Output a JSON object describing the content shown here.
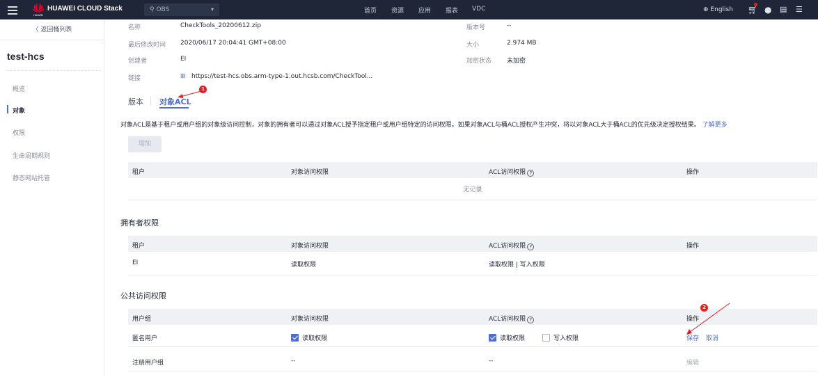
{
  "topbar": {
    "brand": "HUAWEI CLOUD Stack",
    "logo_sub": "HUAWEI",
    "region": "OBS",
    "nav": [
      "首页",
      "资源",
      "应用",
      "报表",
      "VDC"
    ],
    "language": "English"
  },
  "sidebar": {
    "back_label": "返回桶列表",
    "bucket_name": "test-hcs",
    "items": [
      {
        "label": "概览",
        "active": false
      },
      {
        "label": "对象",
        "active": true
      },
      {
        "label": "权限",
        "active": false
      },
      {
        "label": "生命周期规则",
        "active": false
      },
      {
        "label": "静态网站托管",
        "active": false
      }
    ]
  },
  "details": {
    "name_label": "名称",
    "name_value": "CheckTools_20200612.zip",
    "version_label": "版本号",
    "version_value": "--",
    "modified_label": "最后修改时间",
    "modified_value": "2020/06/17 20:04:41 GMT+08:00",
    "size_label": "大小",
    "size_value": "2.974 MB",
    "creator_label": "创建者",
    "creator_value": "EI",
    "encrypt_label": "加密状态",
    "encrypt_value": "未加密",
    "link_label": "链接",
    "link_value": "https://test-hcs.obs.arm-type-1.out.hcsb.com/CheckTool..."
  },
  "tabs": {
    "version": "版本",
    "acl": "对象ACL"
  },
  "description": "对象ACL是基于租户或用户组的对象级访问控制，对象的拥有者可以通过对象ACL授予指定租户或用户组特定的访问权限。如果对象ACL与桶ACL授权产生冲突，将以对象ACL大于桶ACL的优先级决定授权结果。",
  "learn_more": "了解更多",
  "add_button": "增加",
  "tenant_table": {
    "headers": [
      "租户",
      "对象访问权限",
      "ACL访问权限",
      "操作"
    ],
    "empty": "无记录"
  },
  "owner_section": {
    "title": "拥有者权限",
    "headers": [
      "租户",
      "对象访问权限",
      "ACL访问权限",
      "操作"
    ],
    "row": {
      "tenant": "EI",
      "object_perm": "读取权限",
      "acl_perm": "读取权限 | 写入权限"
    }
  },
  "public_section": {
    "title": "公共访问权限",
    "headers": [
      "用户组",
      "对象访问权限",
      "ACL访问权限",
      "操作"
    ],
    "rows": [
      {
        "group": "匿名用户",
        "object_read": "读取权限",
        "acl_read": "读取权限",
        "acl_write": "写入权限",
        "save": "保存",
        "cancel": "取消"
      },
      {
        "group": "注册用户组",
        "object_perm": "--",
        "acl_perm": "--",
        "edit": "编辑"
      }
    ]
  },
  "annotations": {
    "badge1": "1",
    "badge2": "2"
  }
}
